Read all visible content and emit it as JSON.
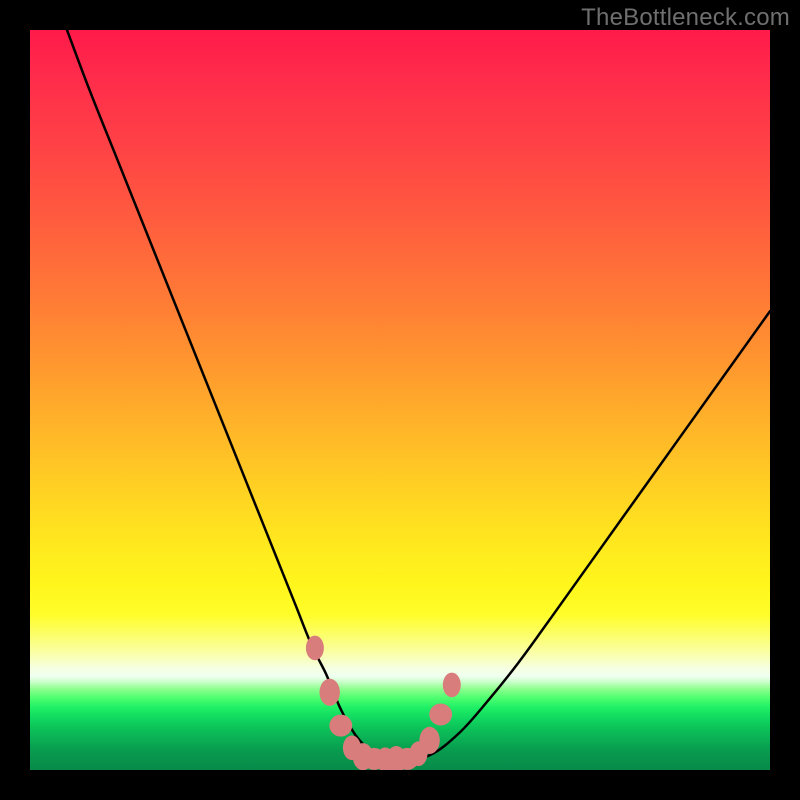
{
  "watermark": "TheBottleneck.com",
  "colors": {
    "curve": "#000000",
    "markers": "#d97c7c",
    "background_frame": "#000000"
  },
  "chart_data": {
    "type": "line",
    "title": "",
    "xlabel": "",
    "ylabel": "",
    "xlim": [
      0,
      100
    ],
    "ylim": [
      0,
      100
    ],
    "grid": false,
    "series": [
      {
        "name": "bottleneck-curve",
        "x": [
          5,
          8,
          12,
          16,
          20,
          24,
          28,
          32,
          34,
          36,
          38,
          40,
          41,
          42,
          43,
          44,
          45,
          46,
          48,
          50,
          54,
          58,
          62,
          66,
          70,
          75,
          80,
          85,
          90,
          95,
          100
        ],
        "y": [
          100,
          92,
          82,
          72,
          62,
          52,
          42,
          32,
          27,
          22,
          17,
          13,
          10.5,
          8.2,
          6.3,
          4.7,
          3.5,
          2.6,
          1.6,
          1.3,
          2.0,
          5.0,
          9.5,
          14.5,
          20,
          27,
          34,
          41,
          48,
          55,
          62
        ]
      }
    ],
    "markers": {
      "name": "highlight-valley",
      "points": [
        {
          "x": 38.5,
          "y": 16.5
        },
        {
          "x": 40.5,
          "y": 10.5
        },
        {
          "x": 42.0,
          "y": 6.0
        },
        {
          "x": 43.5,
          "y": 3.0
        },
        {
          "x": 45.0,
          "y": 1.8
        },
        {
          "x": 46.5,
          "y": 1.5
        },
        {
          "x": 48.0,
          "y": 1.4
        },
        {
          "x": 49.5,
          "y": 1.4
        },
        {
          "x": 51.0,
          "y": 1.5
        },
        {
          "x": 52.5,
          "y": 2.2
        },
        {
          "x": 54.0,
          "y": 4.0
        },
        {
          "x": 55.5,
          "y": 7.5
        },
        {
          "x": 57.0,
          "y": 11.5
        }
      ]
    }
  }
}
